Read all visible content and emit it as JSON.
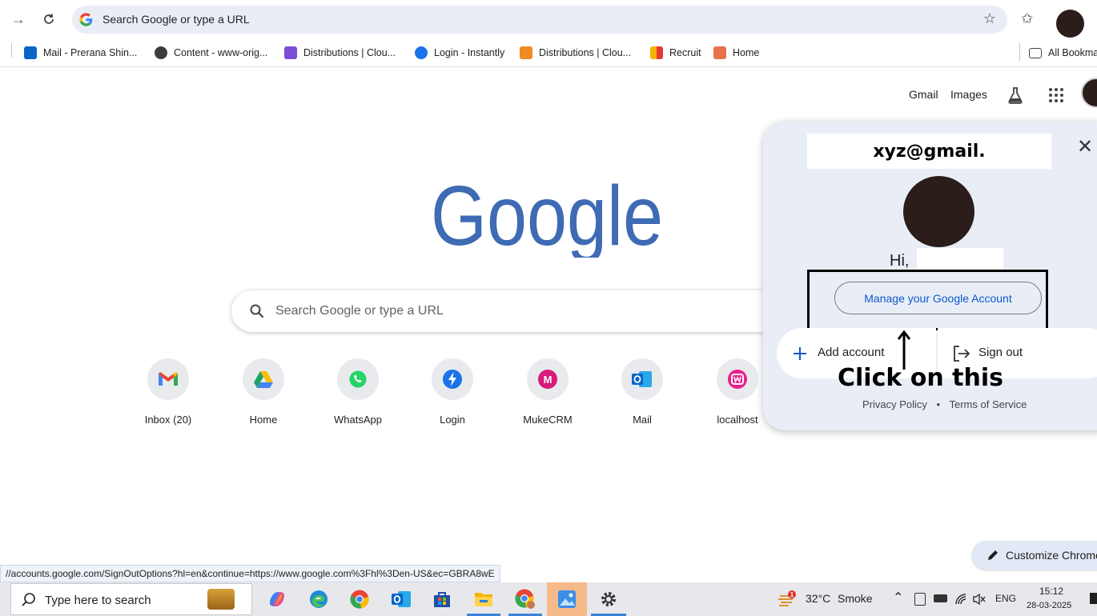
{
  "browser": {
    "omnibox_text": "Search Google or type a URL",
    "bookmarks": [
      {
        "label": "Mail - Prerana Shin...",
        "icon": "outlook-icon"
      },
      {
        "label": "Content - www-orig...",
        "icon": "globe-icon"
      },
      {
        "label": "Distributions | Clou...",
        "icon": "cloud-icon"
      },
      {
        "label": "Login - Instantly",
        "icon": "instantly-icon"
      },
      {
        "label": "Distributions | Clou...",
        "icon": "cloudfront-icon"
      },
      {
        "label": "Recruit",
        "icon": "recruit-icon"
      },
      {
        "label": "Home",
        "icon": "home-bookmark-icon"
      }
    ],
    "all_bookmarks": "All Bookmarks"
  },
  "page": {
    "gmail_link": "Gmail",
    "images_link": "Images",
    "search_placeholder": "Search Google or type a URL",
    "logo_text": "Google",
    "shortcuts": [
      {
        "label": "Inbox (20)",
        "icon": "gmail-icon"
      },
      {
        "label": "Home",
        "icon": "drive-icon"
      },
      {
        "label": "WhatsApp",
        "icon": "whatsapp-icon"
      },
      {
        "label": "Login",
        "icon": "instantly-icon"
      },
      {
        "label": "MukeCRM",
        "icon": "mukecrm-icon"
      },
      {
        "label": "Mail",
        "icon": "outlook-icon"
      },
      {
        "label": "localhost",
        "icon": "wamp-icon"
      }
    ],
    "status_url": "//accounts.google.com/SignOutOptions?hl=en&continue=https://www.google.com%3Fhl%3Den-US&ec=GBRA8wE",
    "customize_chrome": "Customize Chrome"
  },
  "account_panel": {
    "email": "xyz@gmail.",
    "greeting": "Hi,",
    "manage_button": "Manage your Google Account",
    "add_account": "Add account",
    "sign_out": "Sign out",
    "annotation": "Click on this",
    "privacy_policy": "Privacy Policy",
    "separator": "•",
    "terms_of_service": "Terms of Service"
  },
  "taskbar": {
    "search_placeholder": "Type here to search",
    "weather_temp": "32°C",
    "weather_desc": "Smoke",
    "language": "ENG",
    "time": "15:12",
    "date": "28-03-2025",
    "weather_badge": "1"
  },
  "colors": {
    "accent_blue": "#0b57d0",
    "panel_bg": "#e9eef6",
    "google_blue": "#3e6bb4"
  }
}
